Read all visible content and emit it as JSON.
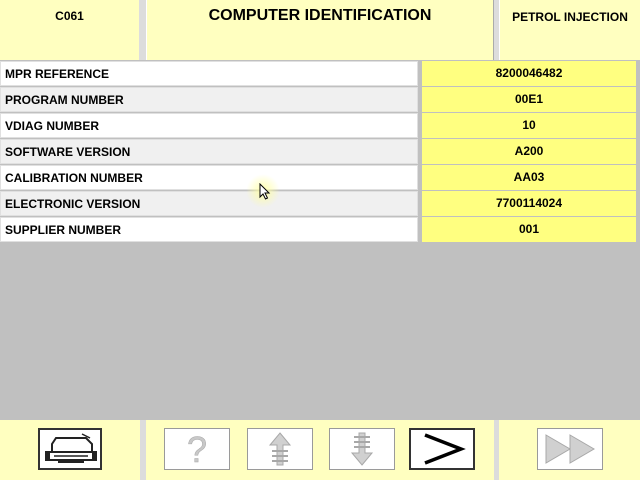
{
  "header": {
    "left": "C061",
    "title": "COMPUTER IDENTIFICATION",
    "right": "PETROL INJECTION"
  },
  "rows": [
    {
      "label": "MPR REFERENCE",
      "value": "8200046482"
    },
    {
      "label": "PROGRAM NUMBER",
      "value": "00E1"
    },
    {
      "label": "VDIAG NUMBER",
      "value": "10"
    },
    {
      "label": "SOFTWARE VERSION",
      "value": "A200"
    },
    {
      "label": "CALIBRATION NUMBER",
      "value": "AA03"
    },
    {
      "label": "ELECTRONIC VERSION",
      "value": "7700114024"
    },
    {
      "label": "SUPPLIER NUMBER",
      "value": "001"
    }
  ],
  "footer": {
    "buttons": [
      {
        "name": "print",
        "icon": "printer-icon",
        "enabled": true
      },
      {
        "name": "help",
        "icon": "question-mark-icon",
        "enabled": false
      },
      {
        "name": "scroll-up",
        "icon": "arrow-up-icon",
        "enabled": false
      },
      {
        "name": "scroll-down",
        "icon": "arrow-down-icon",
        "enabled": false
      },
      {
        "name": "next",
        "icon": "chevron-right-icon",
        "enabled": true
      },
      {
        "name": "fast-forward",
        "icon": "fast-forward-icon",
        "enabled": false
      }
    ]
  },
  "colors": {
    "panel": "#ffffc0",
    "value_cell": "#ffff80",
    "background": "#c0c0c0"
  }
}
